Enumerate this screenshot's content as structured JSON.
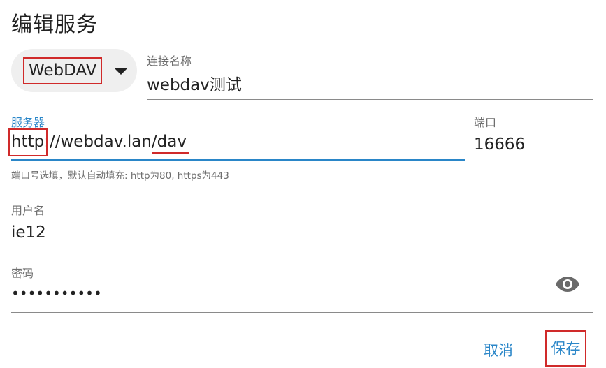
{
  "dialog": {
    "title": "编辑服务"
  },
  "protocol": {
    "selected": "WebDAV"
  },
  "connection_name": {
    "label": "连接名称",
    "value": "webdav测试"
  },
  "server": {
    "label": "服务器",
    "value": "http://webdav.lan/dav",
    "helper": "端口号选填，默认自动填充: http为80, https为443"
  },
  "port": {
    "label": "端口",
    "value": "16666"
  },
  "username": {
    "label": "用户名",
    "value": "ie12"
  },
  "password": {
    "label": "密码",
    "value": "•••••••••••",
    "toggle_icon": "eye-icon"
  },
  "actions": {
    "cancel_label": "取消",
    "save_label": "保存"
  },
  "colors": {
    "accent": "#2a86c8",
    "highlight": "#d02a2a",
    "chip_bg": "#efefef"
  }
}
